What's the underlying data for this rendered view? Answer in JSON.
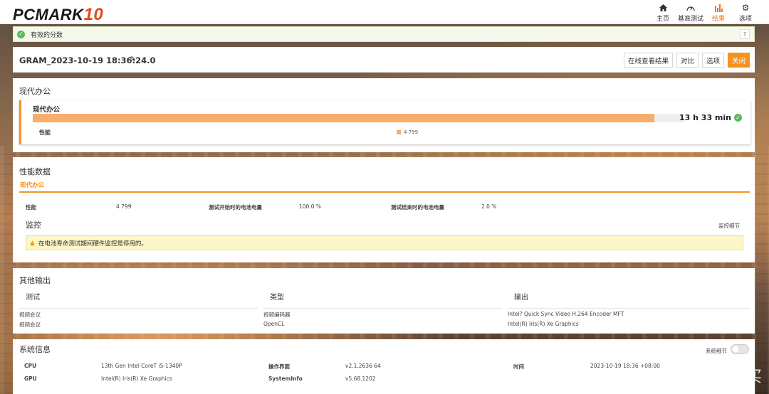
{
  "brand": {
    "name": "PCMARK",
    "number": "10"
  },
  "nav": [
    {
      "label": "主页",
      "icon": "home-icon"
    },
    {
      "label": "基准测试",
      "icon": "gauge-icon"
    },
    {
      "label": "结果",
      "icon": "bar-chart-icon",
      "active": true
    },
    {
      "label": "选项",
      "icon": "gear-icon"
    }
  ],
  "banner": {
    "text": "有效的分数",
    "help": "?"
  },
  "result": {
    "title": "GRAM_2023-10-19 18:36:24.0",
    "buttons": {
      "online": "在线查看结果",
      "compare": "对比",
      "options": "选项",
      "close": "关闭"
    }
  },
  "office": {
    "heading": "现代办公",
    "card_label": "现代办公",
    "score": "13 h 33 min",
    "progress": 0.955,
    "sub_label": "性能",
    "sub_value": "4 799"
  },
  "performance": {
    "heading": "性能数据",
    "tab": "现代办公",
    "items": [
      {
        "key": "性能",
        "value": "4 799"
      },
      {
        "key": "测试开始时的电池电量",
        "value": "100.0 %"
      },
      {
        "key": "测试结束时的电池电量",
        "value": "2.0 %"
      }
    ],
    "monitor_heading": "监控",
    "monitor_link": "监控细节",
    "warning": "在电池寿命测试期间硬件监控是停用的。"
  },
  "other": {
    "heading": "其他输出",
    "columns": [
      "测试",
      "类型",
      "输出"
    ],
    "rows": [
      [
        "视频会议",
        "视频编码器",
        "Intel? Quick Sync Video H.264 Encoder MFT"
      ],
      [
        "视频会议",
        "OpenCL",
        "Intel(R) Iris(R) Xe Graphics"
      ]
    ]
  },
  "system": {
    "heading": "系统信息",
    "toggle_label": "系统细节",
    "rows": [
      {
        "k1": "CPU",
        "v1": "13th Gen Intel CoreT i5-1340P",
        "k2": "操作界面",
        "v2": "v2.1.2636 64",
        "k3": "时间",
        "v3": "2023-10-19 18:36 +08:00"
      },
      {
        "k1": "GPU",
        "v1": "Intel(R) Iris(R) Xe Graphics",
        "k2": "SystemInfo",
        "v2": "v5.68.1202"
      }
    ]
  },
  "watermark": {
    "text": "什么值得买",
    "glyph": "值"
  },
  "colors": {
    "accent": "#f7921e",
    "bar": "#f9ad6a",
    "ok": "#5cb85c"
  }
}
